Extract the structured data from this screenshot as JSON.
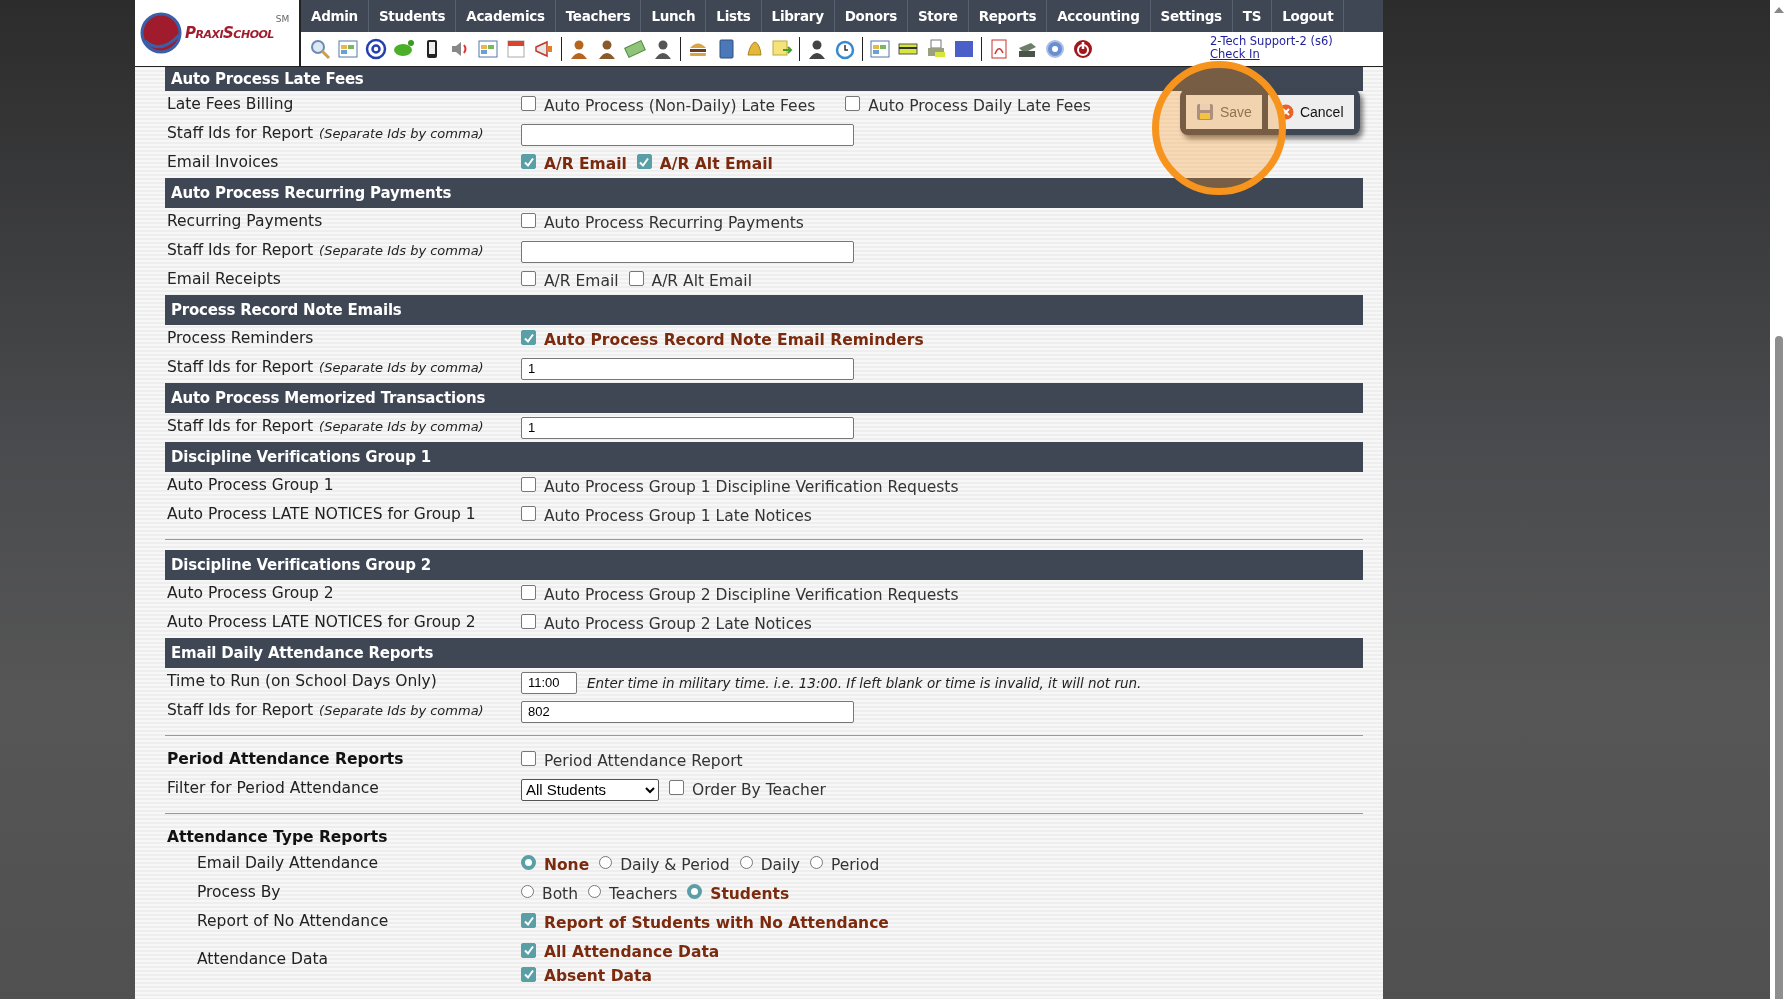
{
  "nav": {
    "logo": "PraxiSchool",
    "logo_mark": "SM",
    "items": [
      "Admin",
      "Students",
      "Academics",
      "Teachers",
      "Lunch",
      "Lists",
      "Library",
      "Donors",
      "Store",
      "Reports",
      "Accounting",
      "Settings",
      "TS",
      "Logout"
    ]
  },
  "user": {
    "name": "2-Tech Support-2 (s6)",
    "link": "Check In"
  },
  "actions": {
    "save": "Save",
    "cancel": "Cancel",
    "highlighted": true
  },
  "sections": [
    {
      "kind": "bar",
      "title": "Auto Process Late Fees",
      "rule_before": false,
      "rows": [
        {
          "label": "Late Fees Billing",
          "kind": "checks",
          "options": [
            {
              "label": "Auto Process (Non-Daily) Late Fees",
              "checked": false
            },
            {
              "label": "Auto Process Daily Late Fees",
              "checked": false
            }
          ]
        },
        {
          "label": "Staff Ids for Report",
          "hint": "(Separate Ids by comma)",
          "kind": "input"
        },
        {
          "label": "Email Invoices",
          "kind": "checks",
          "options": [
            {
              "label": "A/R Email",
              "checked": true
            },
            {
              "label": "A/R Alt Email",
              "checked": true
            }
          ]
        }
      ]
    },
    {
      "kind": "bar",
      "title": "Auto Process Recurring Payments",
      "rule_before": false,
      "rows": [
        {
          "label": "Recurring Payments",
          "kind": "checks",
          "options": [
            {
              "label": "Auto Process Recurring Payments",
              "checked": false
            }
          ]
        },
        {
          "label": "Staff Ids for Report",
          "hint": "(Separate Ids by comma)",
          "kind": "input"
        },
        {
          "label": "Email Receipts",
          "kind": "checks",
          "options": [
            {
              "label": "A/R Email",
              "checked": false
            },
            {
              "label": "A/R Alt Email",
              "checked": false
            }
          ]
        }
      ]
    },
    {
      "kind": "bar",
      "title": "Process Record Note Emails",
      "rule_before": false,
      "rows": [
        {
          "label": "Process Reminders",
          "kind": "checks",
          "options": [
            {
              "label": "Auto Process Record Note Email Reminders",
              "checked": true
            }
          ]
        },
        {
          "label": "Staff Ids for Report",
          "hint": "(Separate Ids by comma)",
          "kind": "input",
          "value": "1"
        }
      ]
    },
    {
      "kind": "bar",
      "title": "Auto Process Memorized Transactions",
      "rule_before": false,
      "rows": [
        {
          "label": "Staff Ids for Report",
          "hint": "(Separate Ids by comma)",
          "kind": "input",
          "value": "1"
        }
      ]
    },
    {
      "kind": "bar",
      "title": "Discipline Verifications Group 1",
      "rule_before": false,
      "rows": [
        {
          "label": "Auto Process Group 1",
          "kind": "checks",
          "options": [
            {
              "label": "Auto Process Group 1 Discipline Verification Requests",
              "checked": false
            }
          ]
        },
        {
          "label": "Auto Process LATE NOTICES for Group 1",
          "kind": "checks",
          "options": [
            {
              "label": "Auto Process Group 1 Late Notices",
              "checked": false
            }
          ]
        }
      ]
    },
    {
      "kind": "bar",
      "title": "Discipline Verifications Group 2",
      "rule_before": true,
      "rows": [
        {
          "label": "Auto Process Group 2",
          "kind": "checks",
          "options": [
            {
              "label": "Auto Process Group 2 Discipline Verification Requests",
              "checked": false
            }
          ]
        },
        {
          "label": "Auto Process LATE NOTICES for Group 2",
          "kind": "checks",
          "options": [
            {
              "label": "Auto Process Group 2 Late Notices",
              "checked": false
            }
          ]
        }
      ]
    },
    {
      "kind": "bar",
      "title": "Email Daily Attendance Reports",
      "rule_before": false,
      "rows": [
        {
          "label": "Time to Run (on School Days Only)",
          "kind": "time",
          "value": "11:00",
          "note": "Enter time in military time. i.e. 13:00. If left blank or time is invalid, it will not run."
        },
        {
          "label": "Staff Ids for Report",
          "hint": "(Separate Ids by comma)",
          "kind": "input",
          "value": "802"
        }
      ]
    },
    {
      "kind": "none",
      "rule_before": true,
      "rows": [
        {
          "label": "Period Attendance Reports",
          "strong": true,
          "kind": "checks",
          "options": [
            {
              "label": "Period Attendance Report",
              "checked": false
            }
          ]
        },
        {
          "label": "Filter for Period Attendance",
          "kind": "select",
          "value": "All Students",
          "options": [
            {
              "label": "Order By Teacher",
              "checked": false
            }
          ]
        }
      ]
    },
    {
      "kind": "heading",
      "title": "Attendance Type Reports",
      "rule_before": true,
      "rows": [
        {
          "label": "Email Daily Attendance",
          "kind": "radios",
          "options": [
            {
              "label": "None",
              "selected": true
            },
            {
              "label": "Daily & Period",
              "selected": false
            },
            {
              "label": "Daily",
              "selected": false
            },
            {
              "label": "Period",
              "selected": false
            }
          ]
        },
        {
          "label": "Process By",
          "kind": "radios",
          "options": [
            {
              "label": "Both",
              "selected": false
            },
            {
              "label": "Teachers",
              "selected": false
            },
            {
              "label": "Students",
              "selected": true
            }
          ]
        },
        {
          "label": "Report of No Attendance",
          "kind": "checks",
          "options": [
            {
              "label": "Report of Students with No Attendance",
              "checked": true
            }
          ]
        },
        {
          "label": "Attendance Data",
          "kind": "stack",
          "options": [
            {
              "label": "All Attendance Data",
              "checked": true
            },
            {
              "label": "Absent Data",
              "checked": true
            }
          ]
        }
      ]
    }
  ]
}
